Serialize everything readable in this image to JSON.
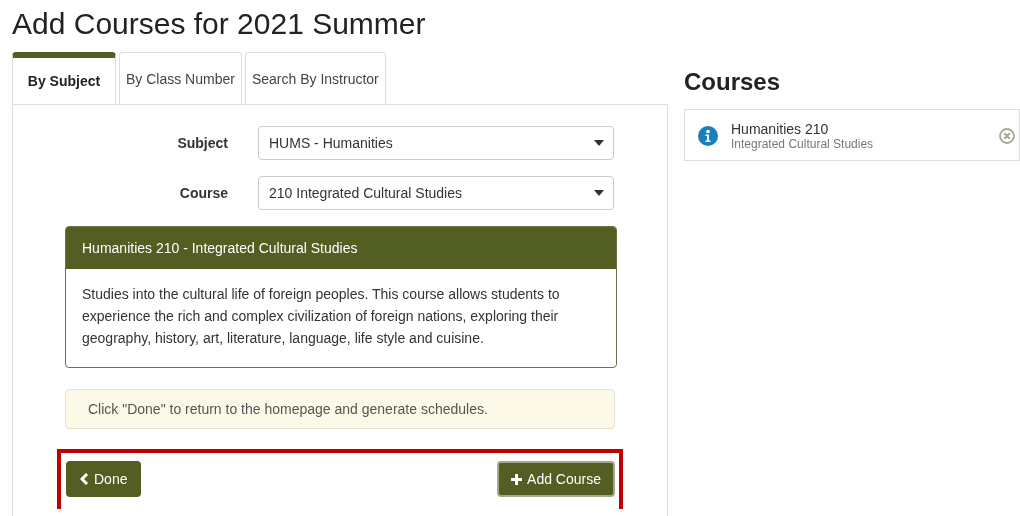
{
  "title": "Add Courses for 2021 Summer",
  "tabs": [
    {
      "label": "By Subject",
      "selected": true
    },
    {
      "label": "By Class Number",
      "selected": false
    },
    {
      "label": "Search By Instructor",
      "selected": false
    }
  ],
  "form": [
    {
      "label": "Subject",
      "value": "HUMS - Humanities"
    },
    {
      "label": "Course",
      "value": "210 Integrated Cultural Studies"
    }
  ],
  "course_card": {
    "title": "Humanities 210 - Integrated Cultural Studies",
    "description": "Studies into the cultural life of foreign peoples. This course allows students to experience the rich and complex civilization of foreign nations, exploring their geography, history, art, literature, language, life style and cuisine."
  },
  "notice": "Click \"Done\" to return to the homepage and generate schedules.",
  "buttons": [
    {
      "label": "Done",
      "kind": "back"
    },
    {
      "label": "Add Course",
      "kind": "add"
    }
  ],
  "courses": {
    "heading": "Courses",
    "items": [
      {
        "name": "Humanities 210",
        "subtitle": "Integrated Cultural Studies"
      }
    ]
  }
}
